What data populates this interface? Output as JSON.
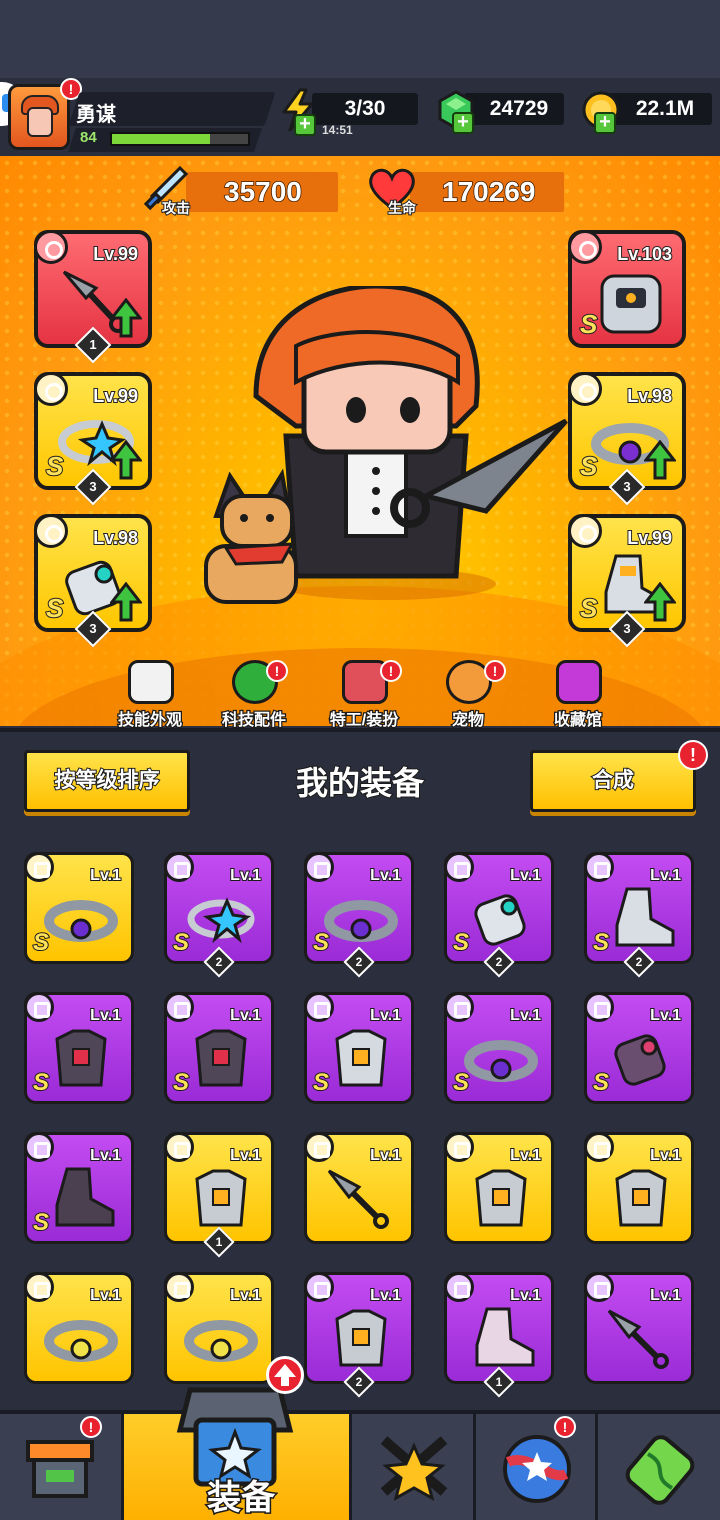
{
  "player": {
    "name": "勇谋",
    "level": "84",
    "xp_fraction": 0.72
  },
  "resources": {
    "energy": "3/30",
    "energy_timer": "14:51",
    "gems": "24729",
    "coins": "22.1M"
  },
  "stats": {
    "attack_label": "攻击",
    "attack_value": "35700",
    "hp_label": "生命",
    "hp_value": "170269"
  },
  "equipped": {
    "weapon": {
      "level": "Lv.99",
      "stars": "1"
    },
    "ring": {
      "level": "Lv.99",
      "grade": "S",
      "stars": "3"
    },
    "glove": {
      "level": "Lv.98",
      "grade": "S",
      "stars": "3"
    },
    "armor": {
      "level": "Lv.103",
      "grade": "S"
    },
    "belt": {
      "level": "Lv.98",
      "grade": "S",
      "stars": "3"
    },
    "boots": {
      "level": "Lv.99",
      "grade": "S",
      "stars": "3"
    }
  },
  "features": [
    {
      "label": "技能外观"
    },
    {
      "label": "科技配件"
    },
    {
      "label": "特工/装扮"
    },
    {
      "label": "宠物"
    },
    {
      "label": "收藏馆"
    }
  ],
  "inventory": {
    "sort_label": "按等级排序",
    "title": "我的装备",
    "merge_label": "合成",
    "items": [
      {
        "level": "Lv.1",
        "grade": "S",
        "qty": ""
      },
      {
        "level": "Lv.1",
        "grade": "S",
        "qty": "2"
      },
      {
        "level": "Lv.1",
        "grade": "S",
        "qty": "2"
      },
      {
        "level": "Lv.1",
        "grade": "S",
        "qty": "2"
      },
      {
        "level": "Lv.1",
        "grade": "S",
        "qty": "2"
      },
      {
        "level": "Lv.1",
        "grade": "S",
        "qty": ""
      },
      {
        "level": "Lv.1",
        "grade": "S",
        "qty": ""
      },
      {
        "level": "Lv.1",
        "grade": "S",
        "qty": ""
      },
      {
        "level": "Lv.1",
        "grade": "S",
        "qty": ""
      },
      {
        "level": "Lv.1",
        "grade": "S",
        "qty": ""
      },
      {
        "level": "Lv.1",
        "grade": "S",
        "qty": ""
      },
      {
        "level": "Lv.1",
        "grade": "",
        "qty": "1"
      },
      {
        "level": "Lv.1",
        "grade": "",
        "qty": ""
      },
      {
        "level": "Lv.1",
        "grade": "",
        "qty": ""
      },
      {
        "level": "Lv.1",
        "grade": "",
        "qty": ""
      },
      {
        "level": "Lv.1",
        "grade": "",
        "qty": ""
      },
      {
        "level": "Lv.1",
        "grade": "",
        "qty": ""
      },
      {
        "level": "Lv.1",
        "grade": "",
        "qty": "2"
      },
      {
        "level": "Lv.1",
        "grade": "",
        "qty": "1"
      },
      {
        "level": "Lv.1",
        "grade": "",
        "qty": ""
      }
    ]
  },
  "bottom_nav": {
    "equip_label": "装备"
  },
  "colors": {
    "rarity_s_yellow": "#ffc600",
    "rarity_purple": "#9b2fd8",
    "rarity_red": "#e53443",
    "alert": "#e8232f"
  }
}
